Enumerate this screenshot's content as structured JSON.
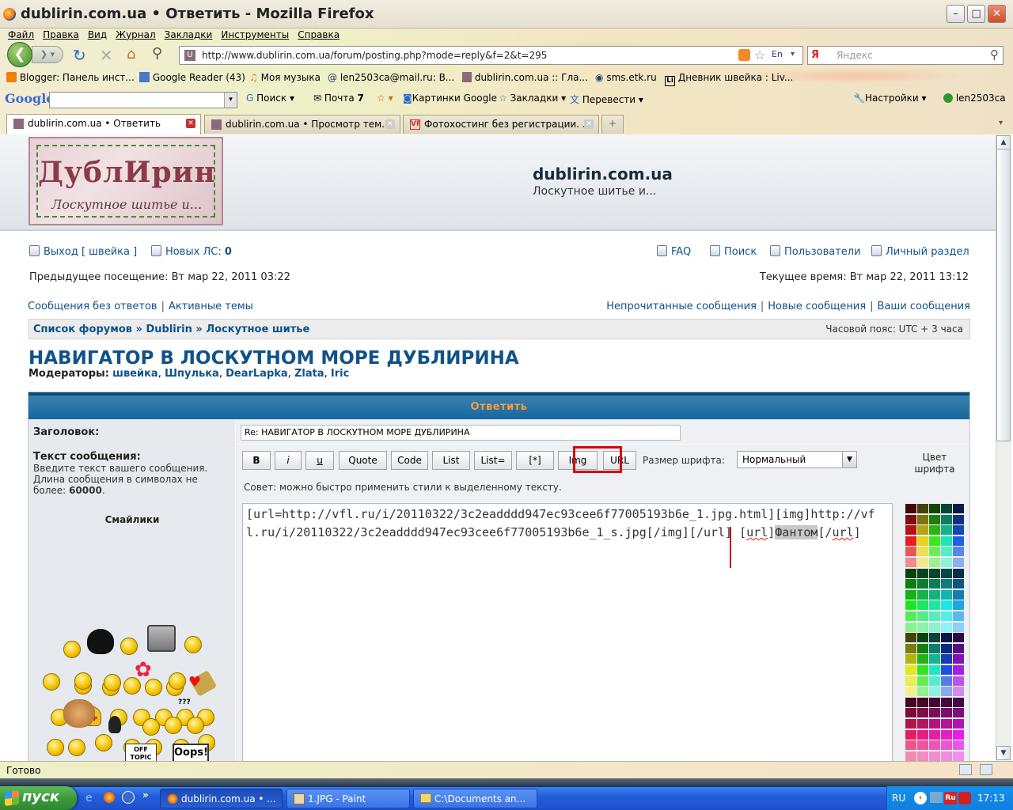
{
  "window": {
    "title": "dublirin.com.ua • Ответить - Mozilla Firefox"
  },
  "menu": [
    "Файл",
    "Правка",
    "Вид",
    "Журнал",
    "Закладки",
    "Инструменты",
    "Справка"
  ],
  "nav": {
    "url": "http://www.dublirin.com.ua/forum/posting.php?mode=reply&f=2&t=295",
    "search_placeholder": "Яндекс"
  },
  "bookmarks": [
    "Blogger: Панель инст...",
    "Google Reader (43)",
    "Моя музыка",
    "len2503ca@mail.ru: В...",
    "dublirin.com.ua :: Гла...",
    "sms.etk.ru",
    "Дневник швейка : Liv..."
  ],
  "google_bar": {
    "logo": "Google",
    "search": "Поиск",
    "mail": "Почта",
    "mail_count": "7",
    "images": "Картинки Google",
    "bookmarks": "Закладки",
    "translate": "Перевести",
    "settings": "Настройки",
    "user": "len2503ca"
  },
  "tabs": [
    {
      "label": "dublirin.com.ua • Ответить"
    },
    {
      "label": "dublirin.com.ua • Просмотр тем..."
    },
    {
      "label": "Фотохостинг без регистрации. ..."
    }
  ],
  "site": {
    "logo_big": "ДублИрин",
    "logo_small": "Лоскутное шитье и...",
    "name": "dublirin.com.ua",
    "desc": "Лоскутное шитье и..."
  },
  "userbar": {
    "logout": "Выход [ швейка ]",
    "pm": "Новых ЛС:",
    "pm_count": "0",
    "faq": "FAQ",
    "search": "Поиск",
    "members": "Пользователи",
    "ucp": "Личный раздел"
  },
  "visits": {
    "last": "Предыдущее посещение: Вт мар 22, 2011 03:22",
    "now": "Текущее время: Вт мар 22, 2011 13:12"
  },
  "links": {
    "unanswered": "Сообщения без ответов",
    "active": "Активные темы",
    "unread": "Непрочитанные сообщения",
    "new": "Новые сообщения",
    "yours": "Ваши сообщения"
  },
  "breadcrumbs": {
    "items": [
      "Список форумов",
      "Dublirin",
      "Лоскутное шитье"
    ],
    "timezone": "Часовой пояс: UTC + 3 часа"
  },
  "forum": {
    "title": "НАВИГАТОР В ЛОСКУТНОМ МОРЕ ДУБЛИРИНА",
    "mods_label": "Модераторы:",
    "mods": [
      "швейка",
      "Шпулька",
      "DearLapka",
      "Zlata",
      "Iric"
    ]
  },
  "form": {
    "header": "Ответить",
    "subject_label": "Заголовок:",
    "subject_value": "Re: НАВИГАТОР В ЛОСКУТНОМ МОРЕ ДУБЛИРИНА",
    "text_label": "Текст сообщения:",
    "text_help": "Введите текст вашего сообщения. Длина сообщения в символах не более:",
    "text_max": "60000",
    "smilies_label": "Смайлики",
    "font_size_label": "Размер шрифта:",
    "font_size_value": "Нормальный",
    "color_label": "Цвет шрифта",
    "tip": "Совет: можно быстро применить стили к выделенному тексту.",
    "buttons": [
      "B",
      "i",
      "u",
      "Quote",
      "Code",
      "List",
      "List=",
      "[*]",
      "Img",
      "URL"
    ],
    "body_part1": "[url=http://vfl.ru/i/20110322/3c2eadddd947ec93cee6f77005193b6e_1.jpg.html][img]http://vfl.ru/i/20110322/3c2eadddd947ec93cee6f77005193b6e_1_s.jpg[/img][/url] [",
    "body_url": "url",
    "body_bracket": "]",
    "body_sel": "Фантом",
    "body_end1": "[/",
    "body_end2": "url",
    "body_end3": "]",
    "smilie_text": [
      "HELP",
      "???",
      "OFF TOPIC",
      "Oops!"
    ]
  },
  "status": "Готово",
  "taskbar": {
    "start": "пуск",
    "items": [
      "dublirin.com.ua • ...",
      "1.JPG - Paint",
      "C:\\Documents an..."
    ],
    "lang": "RU",
    "time": "17:13"
  }
}
